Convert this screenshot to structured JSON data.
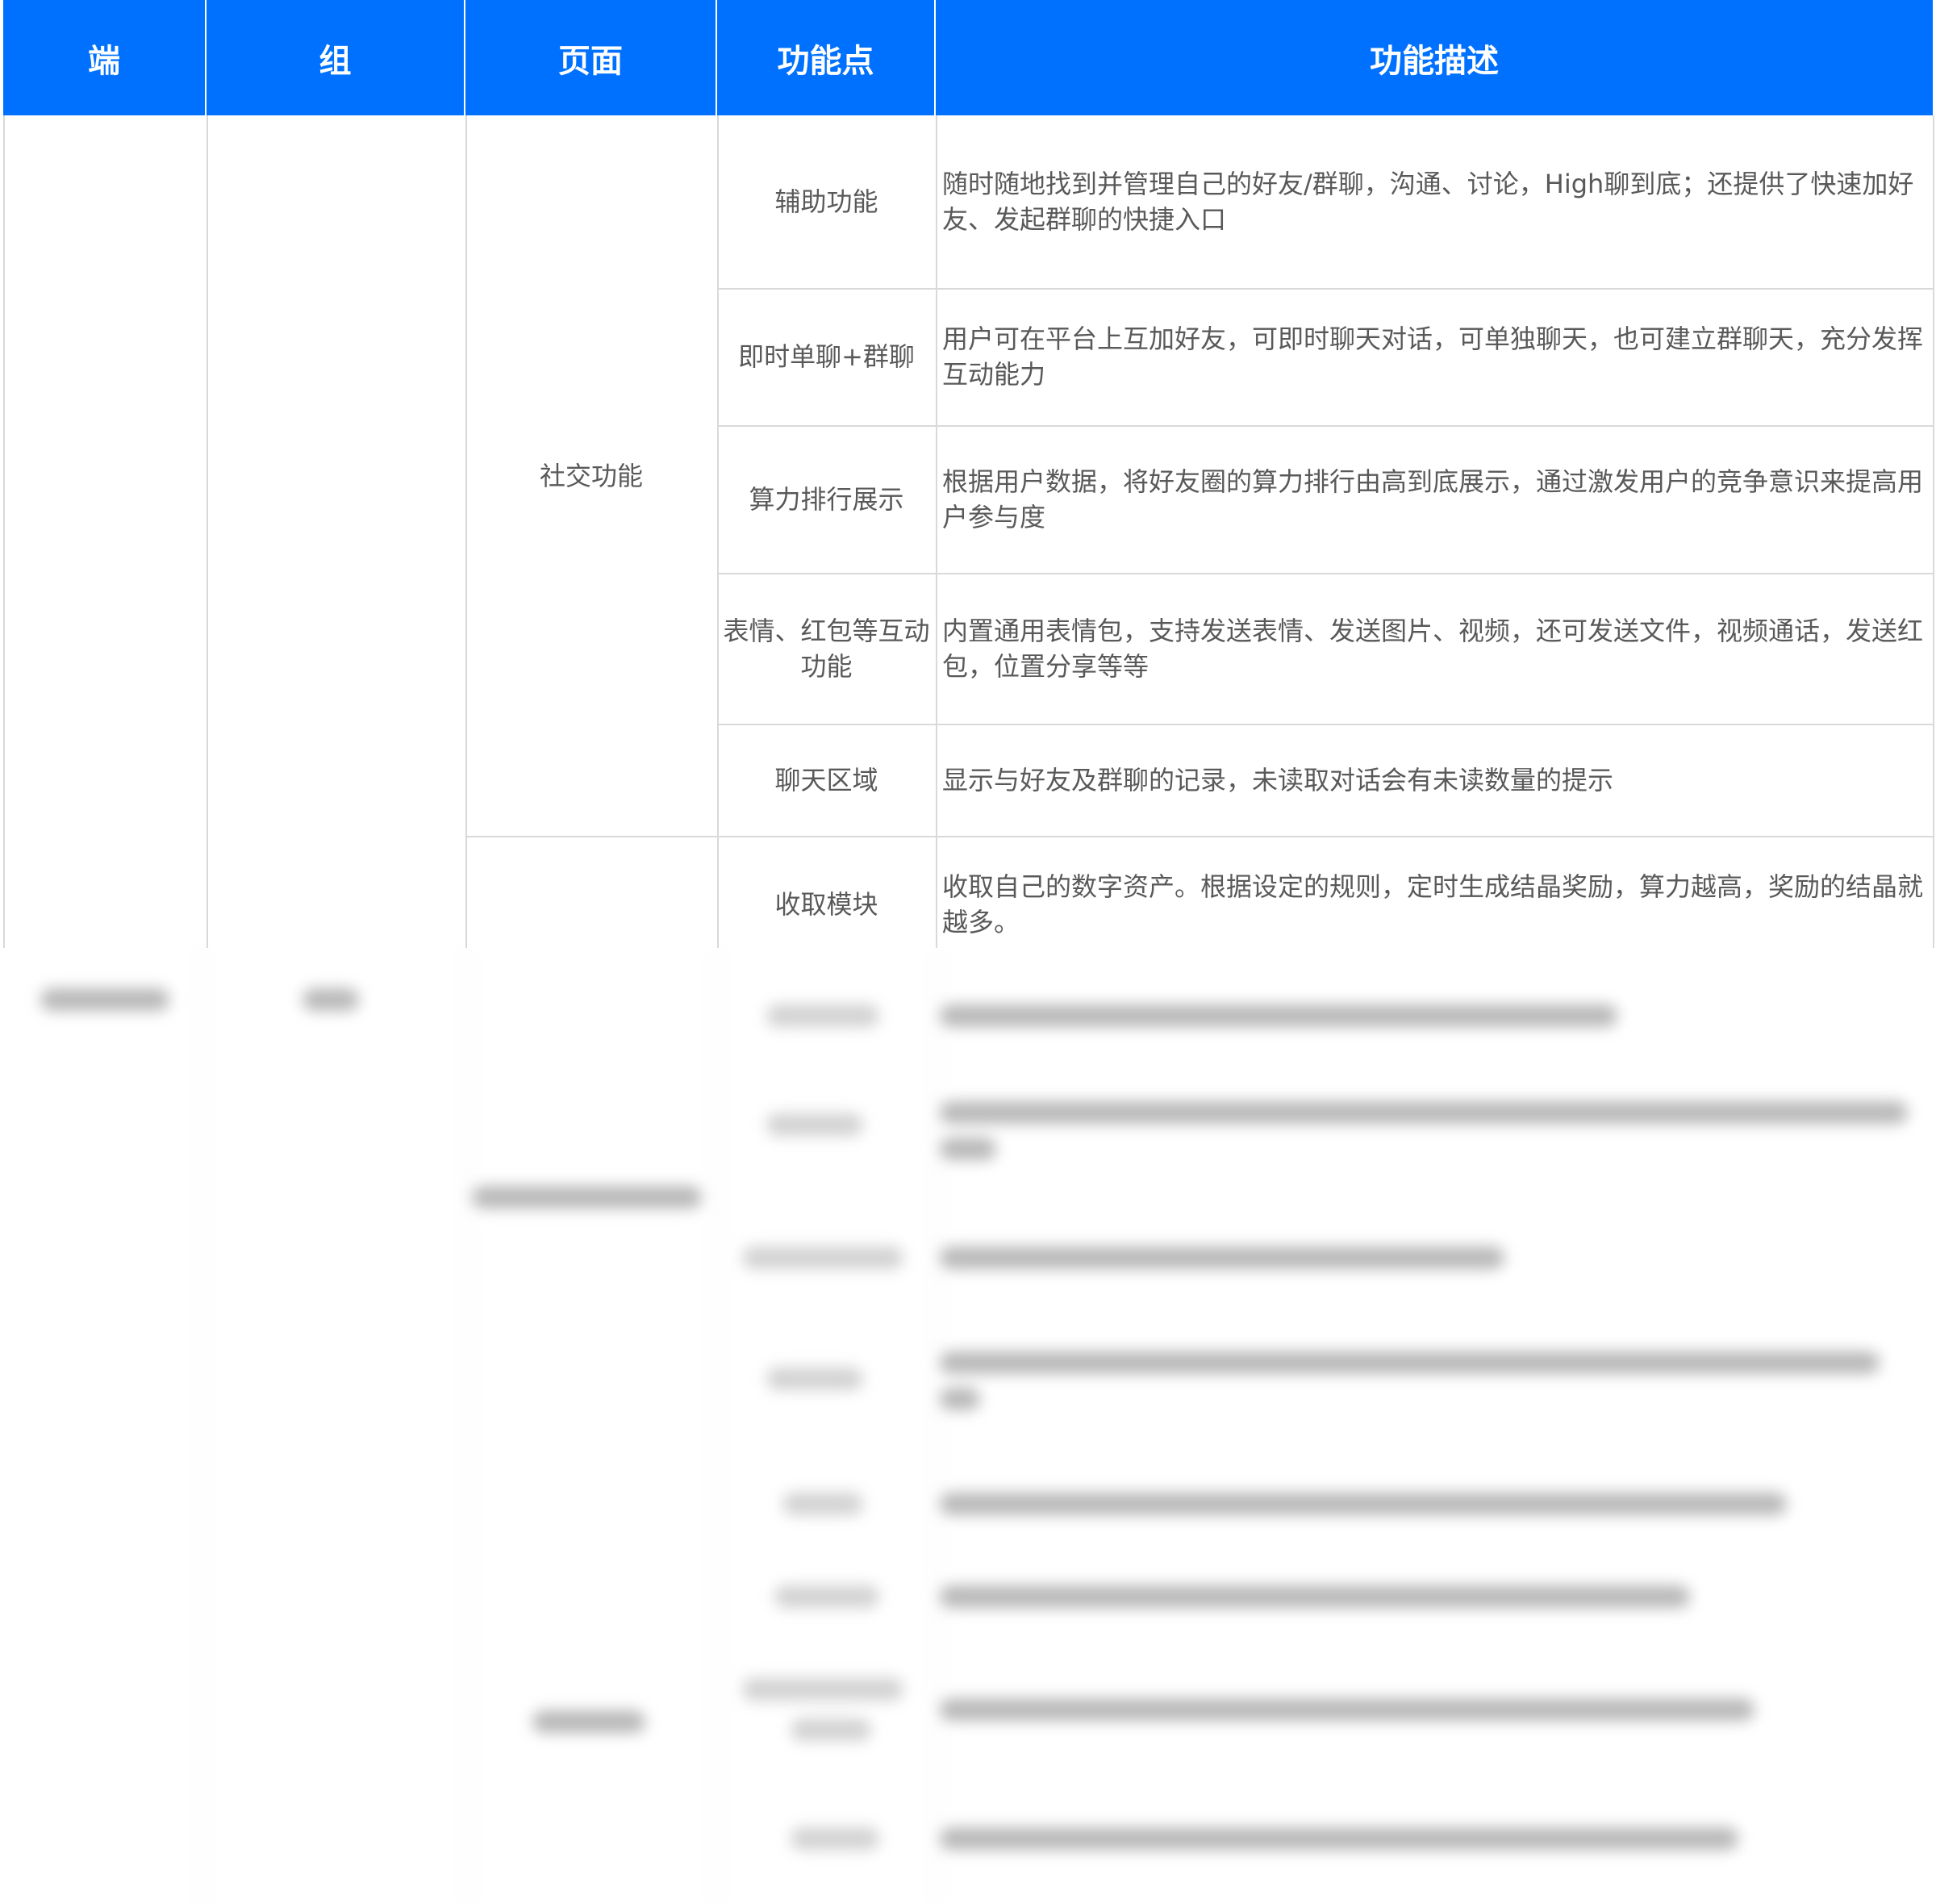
{
  "table": {
    "headers": [
      "端",
      "组",
      "页面",
      "功能点",
      "功能描述"
    ],
    "page_social": "社交功能",
    "rows": [
      {
        "feature": "辅助功能",
        "desc": "随时随地找到并管理自己的好友/群聊，沟通、讨论，High聊到底；还提供了快速加好友、发起群聊的快捷入口"
      },
      {
        "feature": "即时单聊+群聊",
        "desc": "用户可在平台上互加好友，可即时聊天对话，可单独聊天，也可建立群聊天，充分发挥互动能力"
      },
      {
        "feature": "算力排行展示",
        "desc": "根据用户数据，将好友圈的算力排行由高到底展示，通过激发用户的竞争意识来提高用户参与度"
      },
      {
        "feature": "表情、红包等互动功能",
        "desc": "内置通用表情包，支持发送表情、发送图片、视频，还可发送文件，视频通话，发送红包，位置分享等等"
      },
      {
        "feature": "聊天区域",
        "desc": "显示与好友及群聊的记录，未读取对话会有未读数量的提示"
      },
      {
        "feature": "收取模块",
        "desc": "收取自己的数字资产。根据设定的规则，定时生成结晶奖励，算力越高，奖励的结晶就越多。"
      }
    ]
  },
  "colors": {
    "header_bg": "#0071ff",
    "header_text": "#ffffff",
    "grid": "#d9d9d9",
    "body_text": "#595959"
  }
}
